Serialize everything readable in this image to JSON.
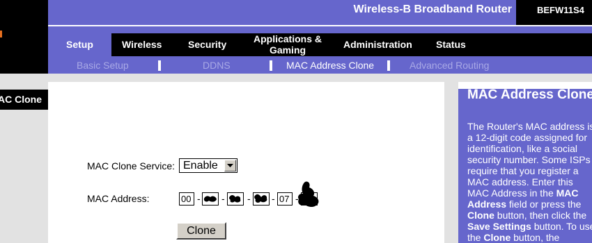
{
  "header": {
    "product_title": "Wireless-B Broadband Router",
    "model": "BEFW11S4"
  },
  "nav": {
    "tabs": [
      {
        "label": "Setup"
      },
      {
        "label": "Wireless"
      },
      {
        "label": "Security"
      },
      {
        "label": "Applications &"
      },
      {
        "label": "Gaming"
      },
      {
        "label": "Administration"
      },
      {
        "label": "Status"
      }
    ],
    "subtabs": [
      {
        "label": "Basic Setup"
      },
      {
        "label": "DDNS"
      },
      {
        "label": "MAC Address Clone"
      },
      {
        "label": "Advanced Routing"
      }
    ]
  },
  "section": {
    "label": "MAC Clone"
  },
  "form": {
    "service_label": "MAC Clone Service:",
    "service_value": "Enable",
    "mac_label": "MAC Address:",
    "mac_fields": [
      "00",
      "",
      "",
      "",
      "07",
      ""
    ],
    "dash": "-",
    "clone_button": "Clone"
  },
  "help": {
    "title": "MAC Address Clone",
    "text_1": "The Router's MAC address is a 12-digit code assigned for identification, like a social security number. Some ISPs require that you register a MAC address. Enter this MAC Address in the ",
    "bold_1": "MAC Address",
    "text_2": " field or press the ",
    "bold_2": "Clone",
    "text_3": " button, then click the ",
    "bold_3": "Save Settings",
    "text_4": " button. To use the ",
    "bold_4": "Clone",
    "text_5": " button, the computer"
  },
  "colors": {
    "brand_purple": "#6666cc",
    "nav_black": "#000000",
    "inactive_sub": "#a9a9e6",
    "panel_gray": "#e2e2e2"
  }
}
